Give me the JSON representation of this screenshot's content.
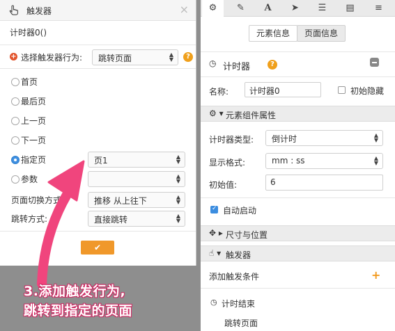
{
  "dialog": {
    "title": "触发器",
    "close": "×",
    "element_name": "计时器0()",
    "action_label": "选择触发器行为:",
    "action_value": "跳转页面",
    "help": "?",
    "radios": [
      {
        "label": "首页",
        "selected": false
      },
      {
        "label": "最后页",
        "selected": false
      },
      {
        "label": "上一页",
        "selected": false
      },
      {
        "label": "下一页",
        "selected": false
      },
      {
        "label": "指定页",
        "selected": true
      },
      {
        "label": "参数",
        "selected": false
      }
    ],
    "page_select_value": "页1",
    "param_select_value": "",
    "transition_label": "页面切换方式:",
    "transition_value": "推移 从上往下",
    "jump_label": "跳转方式:",
    "jump_value": "直接跳转",
    "ok": "✔"
  },
  "panel": {
    "toolbar_icons": [
      "gear-icon",
      "pencil-icon",
      "font-icon",
      "send-icon",
      "list-icon",
      "document-icon",
      "database-icon"
    ],
    "tabs": [
      {
        "label": "元素信息",
        "active": true
      },
      {
        "label": "页面信息",
        "active": false
      }
    ],
    "element_title": "计时器",
    "help": "?",
    "name_label": "名称:",
    "name_value": "计时器0",
    "hidden_label": "初始隐藏",
    "component_section": "元素组件属性",
    "timer_type_label": "计时器类型:",
    "timer_type_value": "倒计时",
    "format_label": "显示格式:",
    "format_value": "mm : ss",
    "initial_label": "初始值:",
    "initial_value": "6",
    "autostart_label": "自动启动",
    "autostart_checked": true,
    "size_section": "尺寸与位置",
    "trigger_section": "触发器",
    "add_condition_label": "添加触发条件",
    "condition_name": "计时结束",
    "condition_action": "跳转页面"
  },
  "annotation": {
    "line1": "3.添加触发行为,",
    "line2": "跳转到指定的页面"
  },
  "colors": {
    "accent_orange": "#f0982a",
    "annotation_pink": "#f0457d",
    "radio_blue": "#3f8fe0"
  }
}
